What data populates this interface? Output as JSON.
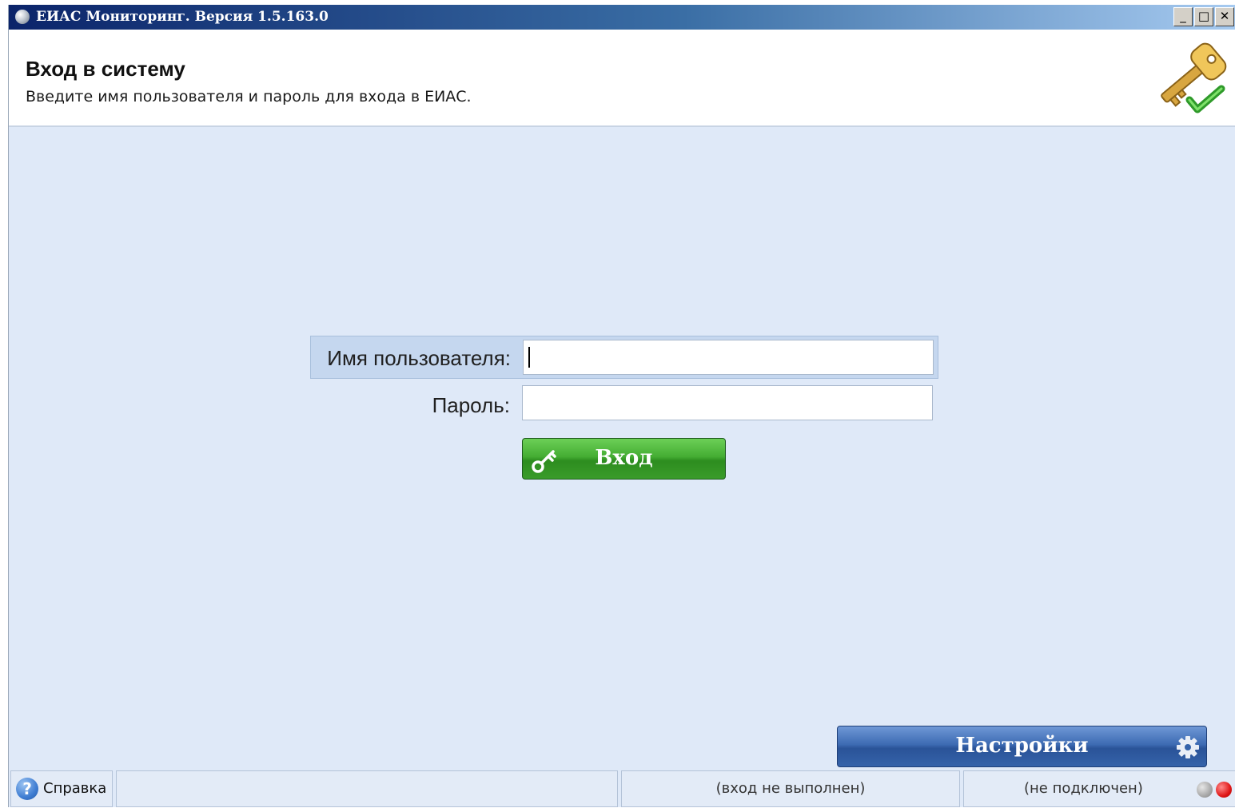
{
  "window": {
    "title": "ЕИАС Мониторинг. Версия 1.5.163.0",
    "controls": {
      "minimize": "_",
      "maximize": "□",
      "close": "✕"
    }
  },
  "header": {
    "title": "Вход в систему",
    "subtitle": "Введите имя пользователя и пароль для входа в ЕИАС.",
    "icon": "key-with-checkmark-icon"
  },
  "login_form": {
    "username_label": "Имя пользователя:",
    "username_value": "",
    "password_label": "Пароль:",
    "password_value": "",
    "submit_label": "Вход",
    "submit_icon": "key-icon",
    "submit_color": "#3c9e2c"
  },
  "settings": {
    "label": "Настройки",
    "icon": "gear-icon",
    "color": "#2f5da6"
  },
  "statusbar": {
    "help_label": "Справка",
    "help_icon": "help-icon",
    "login_status": "(вход не выполнен)",
    "connection_status": "(не подключен)",
    "indicators": [
      "grey",
      "red"
    ]
  }
}
